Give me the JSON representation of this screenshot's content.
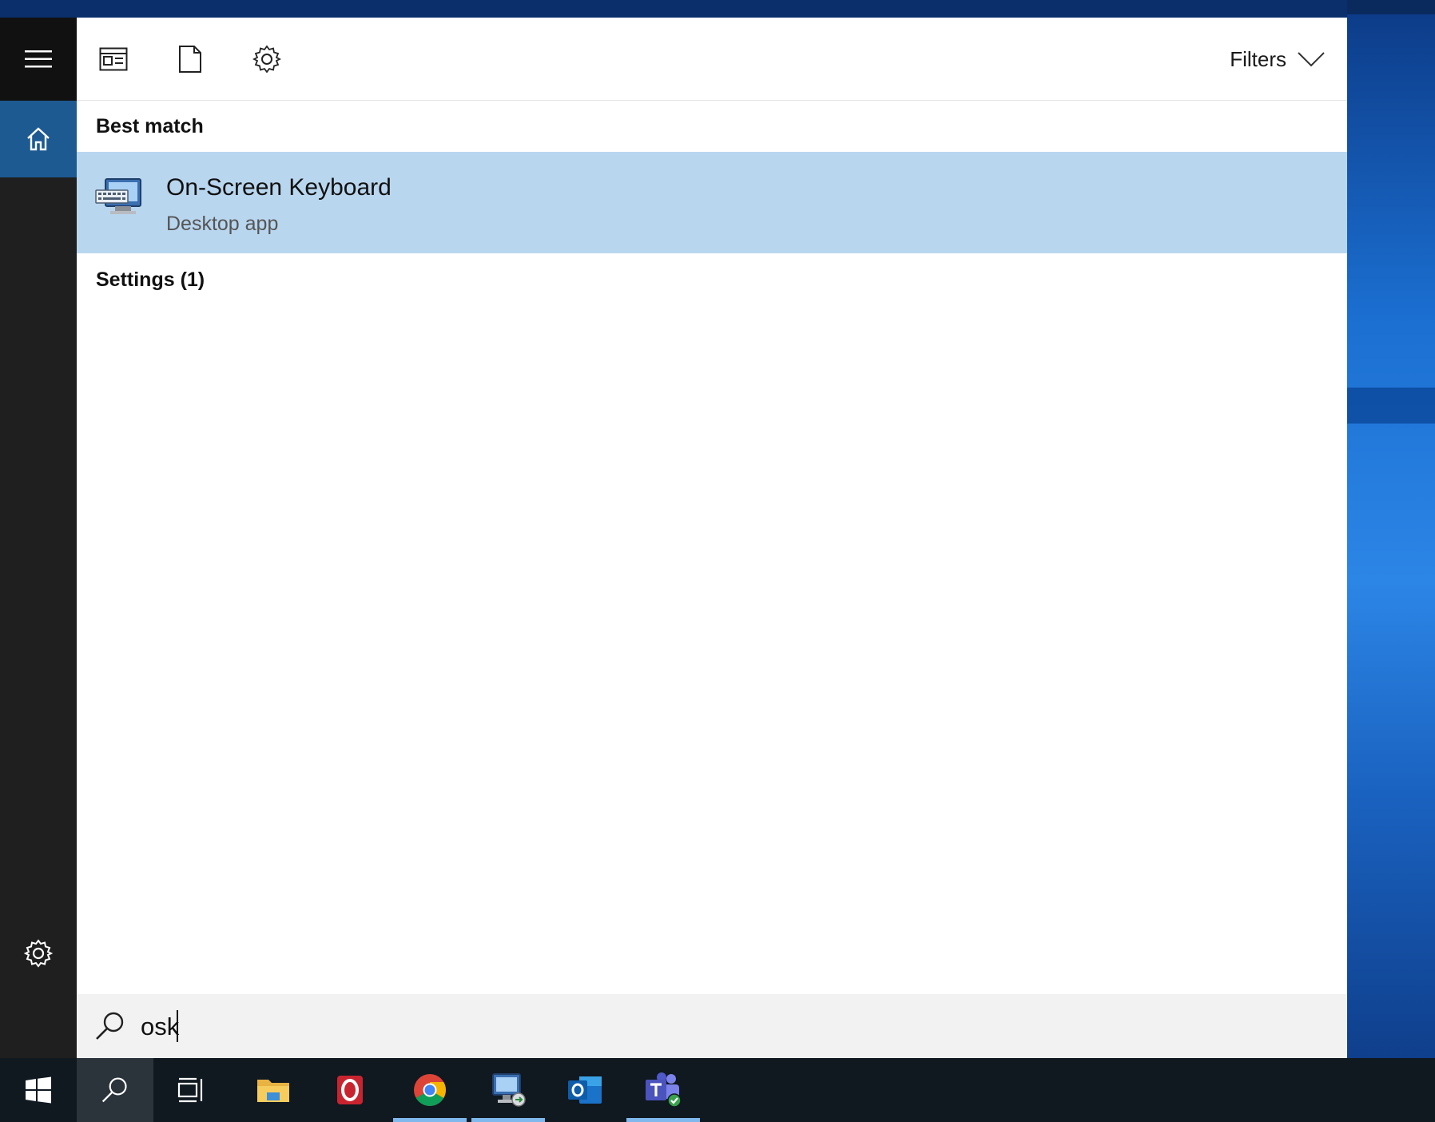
{
  "toolbar": {
    "tabs": [
      "news-icon",
      "document-icon",
      "gear-icon"
    ],
    "filters_label": "Filters"
  },
  "best_match": {
    "heading": "Best match",
    "item": {
      "title": "On-Screen Keyboard",
      "subtitle": "Desktop app"
    }
  },
  "settings_section": {
    "heading": "Settings (1)"
  },
  "search": {
    "value": "osk"
  },
  "taskbar": {
    "items": [
      "start-icon",
      "search-icon",
      "task-view-icon",
      "file-explorer-icon",
      "opera-icon",
      "chrome-icon",
      "remote-desktop-icon",
      "outlook-icon",
      "teams-icon"
    ]
  },
  "colors": {
    "rail": "#1f1f1f",
    "rail_active": "#1d5a91",
    "selection": "#b9d6ef",
    "search_bg": "#f2f2f2",
    "taskbar": "#101820"
  }
}
